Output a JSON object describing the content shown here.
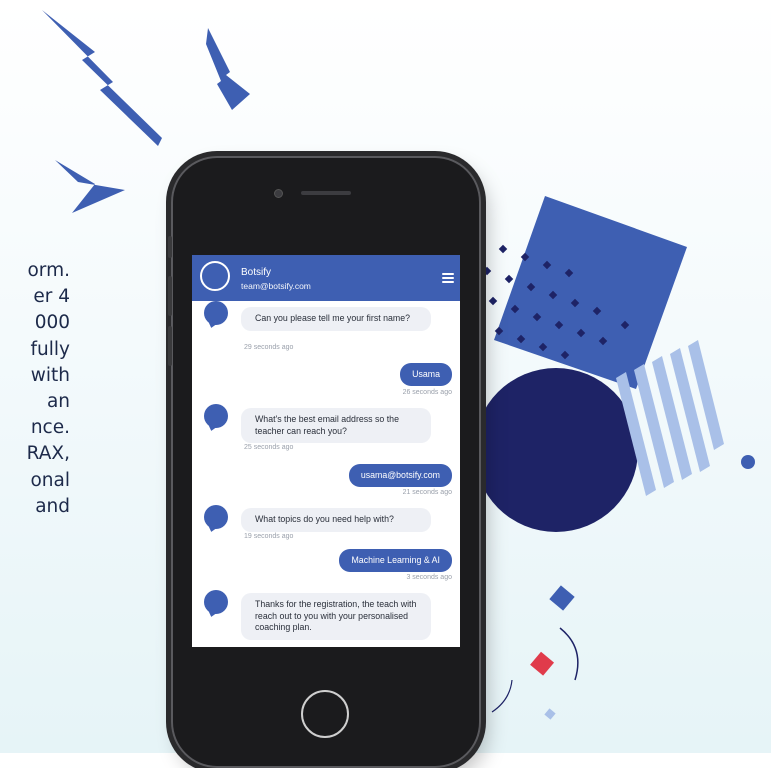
{
  "side_text": {
    "lines": [
      "orm.",
      "er 4",
      "000",
      "fully",
      "with",
      "an",
      "nce.",
      "RAX,",
      "onal",
      "and"
    ]
  },
  "chat": {
    "bot_name": "Botsify",
    "bot_email": "team@botsify.com",
    "messages": [
      {
        "from": "bot",
        "text": "Can you please tell me your first name?",
        "time": "29 seconds ago"
      },
      {
        "from": "user",
        "text": "Usama",
        "time": "26 seconds ago"
      },
      {
        "from": "bot",
        "text": "What's the best email address so the teacher can reach you?",
        "time": "25 seconds ago"
      },
      {
        "from": "user",
        "text": "usama@botsify.com",
        "time": "21 seconds ago"
      },
      {
        "from": "bot",
        "text": "What topics do you need help with?",
        "time": "19 seconds ago"
      },
      {
        "from": "user",
        "text": "Machine Learning & AI",
        "time": "3 seconds ago"
      },
      {
        "from": "bot",
        "text": "Thanks for the registration, the teach with reach out to you with your personalised coaching plan.",
        "time": ""
      }
    ]
  },
  "colors": {
    "accent": "#3e5fb2",
    "navy": "#1e2366",
    "text": "#1d2a4a",
    "bubble_bg": "#eef0f5",
    "decor_red": "#e03b4b"
  },
  "icons": {
    "menu": "hamburger-menu-icon",
    "avatar": "bot-avatar-icon"
  }
}
